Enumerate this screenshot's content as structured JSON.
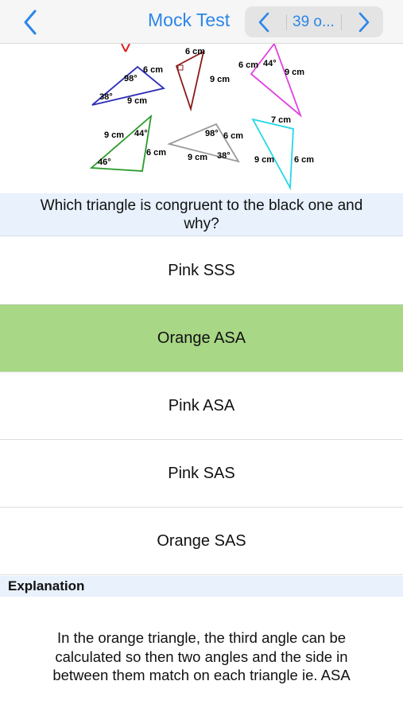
{
  "nav": {
    "title": "Mock Test",
    "pager_text": "39 o..."
  },
  "figure": {
    "labels": {
      "blue_side_a": "6 cm",
      "blue_angle_top": "98°",
      "blue_angle_left": "38°",
      "blue_side_b": "9 cm",
      "brown_side_top": "6 cm",
      "brown_side_right": "9 cm",
      "pink_side_top": "6 cm",
      "pink_angle": "44°",
      "pink_side_right": "9 cm",
      "green_side_left": "9 cm",
      "green_angle_top": "44°",
      "green_side_right": "6 cm",
      "green_angle_bottom": "46°",
      "gray_angle_top": "98°",
      "gray_side_right": "6 cm",
      "gray_side_bottom": "9 cm",
      "gray_angle_right": "38°",
      "cyan_side_top": "7 cm",
      "cyan_side_left": "9 cm",
      "cyan_side_right": "6 cm"
    },
    "colors": {
      "blue": "#2b2bb8",
      "brown": "#8b1a1a",
      "pink": "#e040e0",
      "green": "#2a9a2a",
      "gray": "#9a9a9a",
      "cyan": "#22d8e6",
      "red_mark": "#e02020"
    }
  },
  "question": "Which triangle is congruent to the black one and why?",
  "options": [
    {
      "label": "Pink SSS"
    },
    {
      "label": "Orange ASA",
      "selected": true
    },
    {
      "label": "Pink ASA"
    },
    {
      "label": "Pink SAS"
    },
    {
      "label": "Orange SAS"
    }
  ],
  "explanation": {
    "header": "Explanation",
    "text": "In the orange triangle, the third angle can be calculated so then two angles and the side in between them match on each triangle ie. ASA"
  },
  "accent_color": "#2a86e8",
  "selected_color": "#a8d786"
}
